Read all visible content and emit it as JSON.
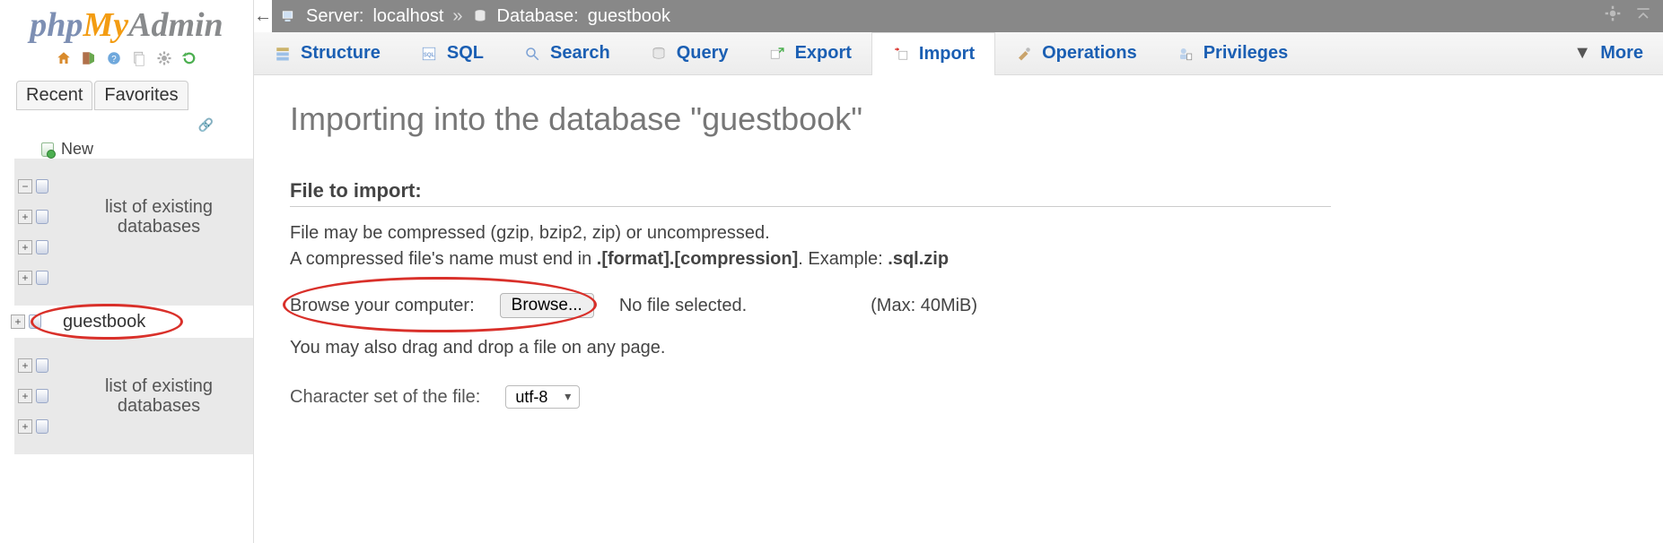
{
  "logo": {
    "php": "php",
    "my": "My",
    "admin": "Admin"
  },
  "sidebar": {
    "tabs": {
      "recent": "Recent",
      "favorites": "Favorites"
    },
    "new_label": "New",
    "placeholder_block": "list of existing\ndatabases",
    "selected_db": "guestbook"
  },
  "breadcrumb": {
    "server_label": "Server:",
    "server_value": "localhost",
    "sep": "»",
    "database_label": "Database:",
    "database_value": "guestbook"
  },
  "tabs": {
    "structure": "Structure",
    "sql": "SQL",
    "search": "Search",
    "query": "Query",
    "export": "Export",
    "import": "Import",
    "operations": "Operations",
    "privileges": "Privileges",
    "more": "More"
  },
  "page": {
    "title": "Importing into the database \"guestbook\"",
    "section_header": "File to import:",
    "line1": "File may be compressed (gzip, bzip2, zip) or uncompressed.",
    "line2_a": "A compressed file's name must end in ",
    "line2_b": ".[format].[compression]",
    "line2_c": ". Example: ",
    "line2_d": ".sql.zip",
    "browse_label": "Browse your computer:",
    "browse_button": "Browse...",
    "no_file": "No file selected.",
    "max": "(Max: 40MiB)",
    "dragdrop": "You may also drag and drop a file on any page.",
    "charset_label": "Character set of the file:",
    "charset_value": "utf-8"
  }
}
